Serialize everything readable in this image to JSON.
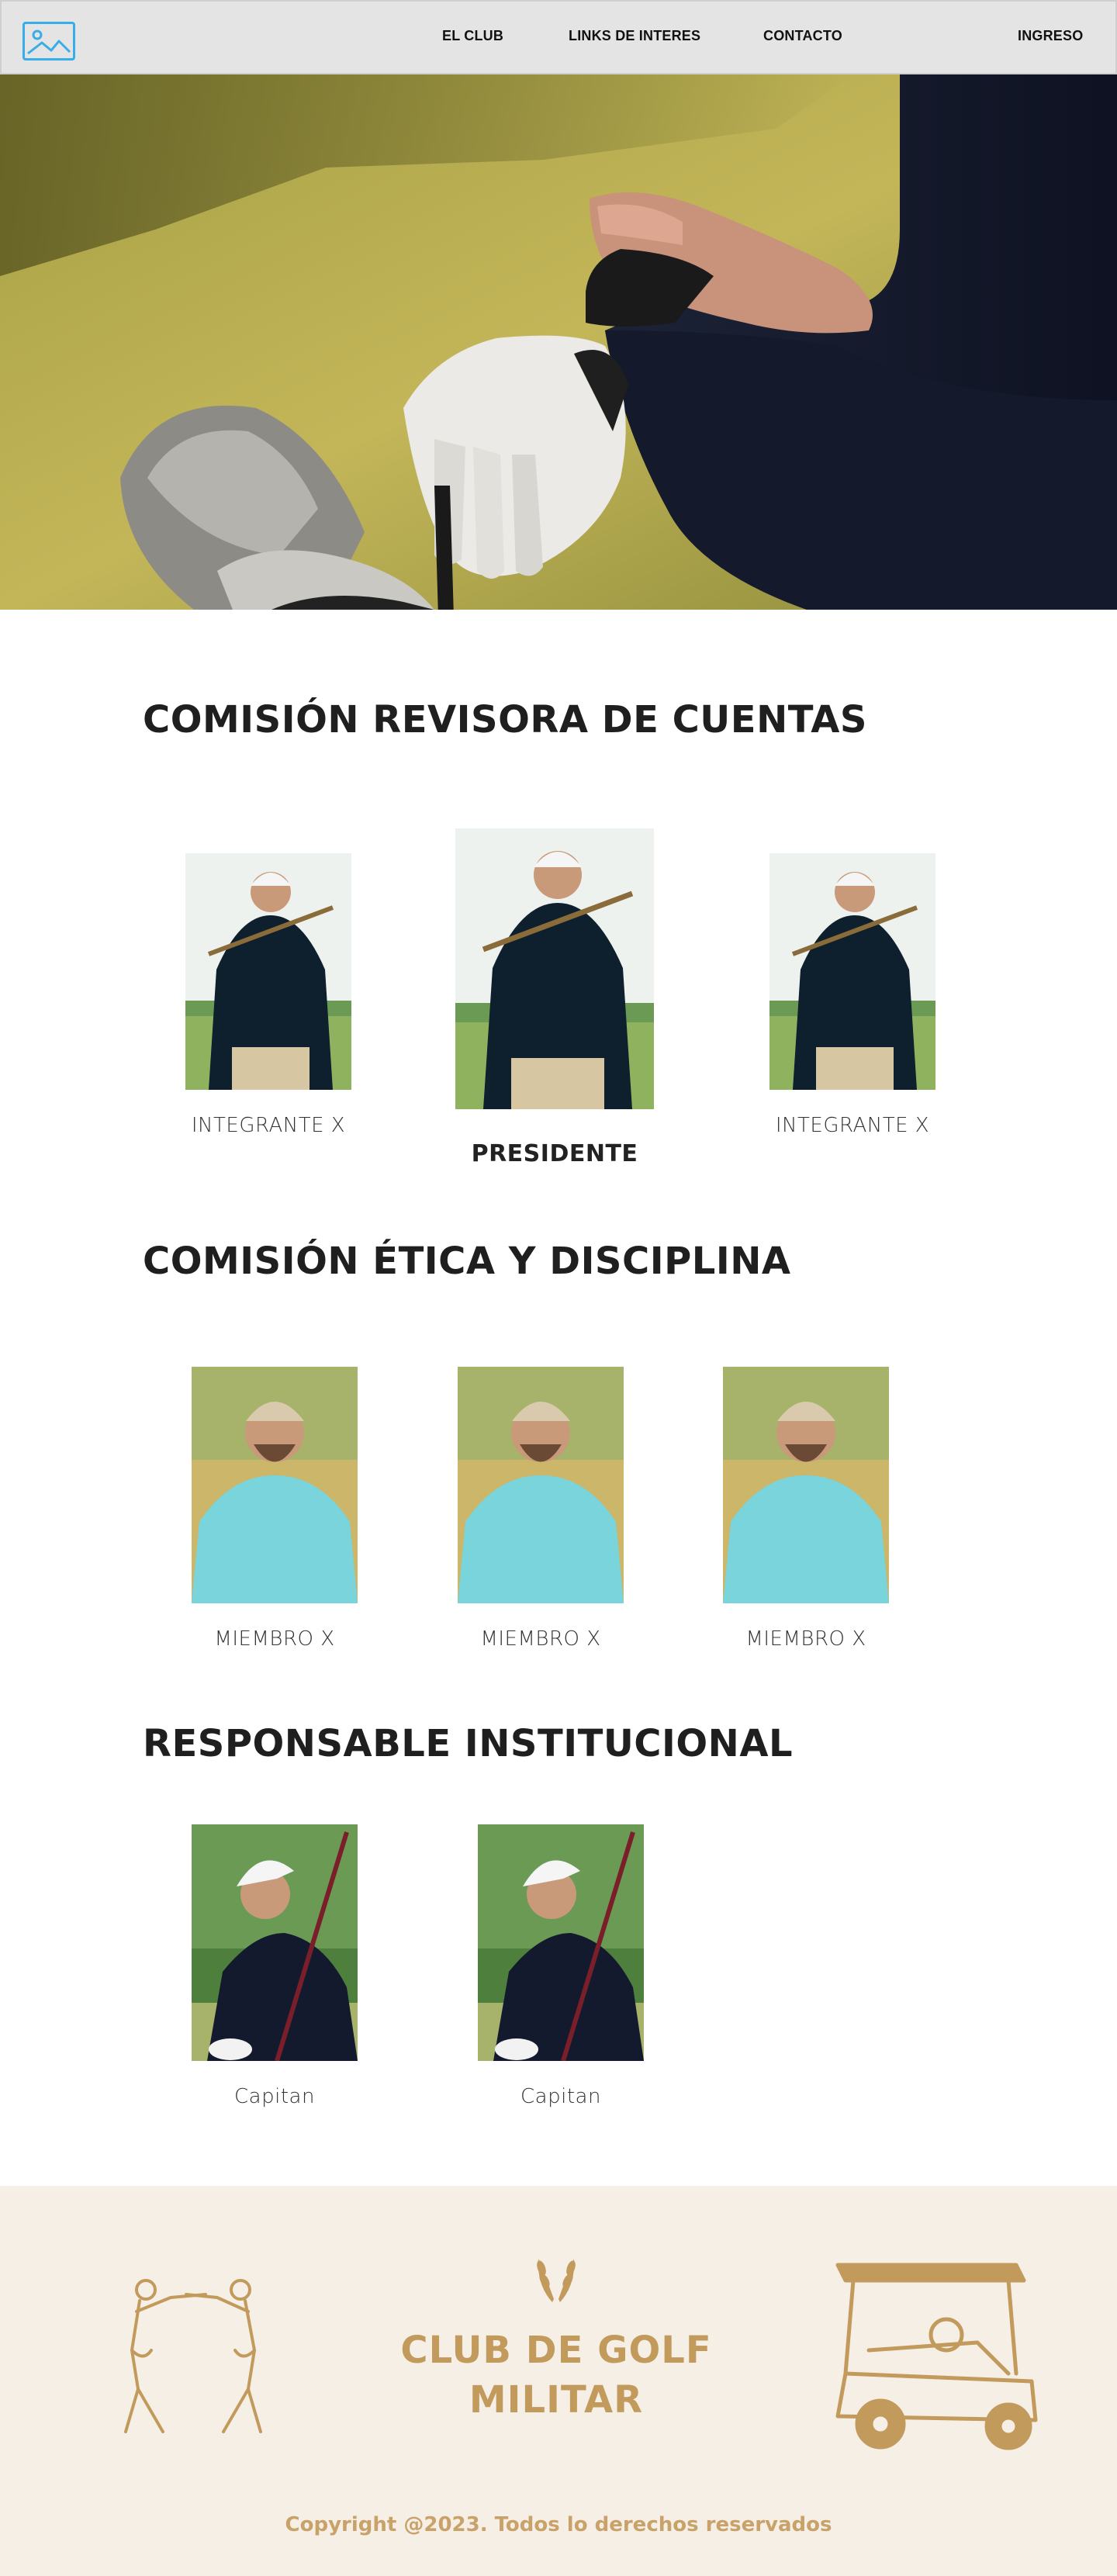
{
  "nav": {
    "links": [
      "EL CLUB",
      "LINKS DE INTERES",
      "CONTACTO"
    ],
    "login": "INGRESO"
  },
  "sections": {
    "revisora": {
      "title": "COMISIÓN REVISORA DE CUENTAS",
      "members": [
        "INTEGRANTE  X",
        "PRESIDENTE",
        "INTEGRANTE  X"
      ]
    },
    "etica": {
      "title": "COMISIÓN ÉTICA Y DISCIPLINA",
      "members": [
        "MIEMBRO X",
        "MIEMBRO X",
        "MIEMBRO X"
      ]
    },
    "responsable": {
      "title": "RESPONSABLE INSTITUCIONAL",
      "members": [
        "Capitan",
        "Capitan"
      ]
    }
  },
  "footer": {
    "club_name_line1": "CLUB DE GOLF",
    "club_name_line2": "MILITAR",
    "copyright": "Copyright @2023. Todos lo derechos reservados"
  },
  "colors": {
    "nav_bg": "#e4e4e4",
    "accent": "#37aee9",
    "footer_bg": "#f5efe6",
    "gold": "#c29a5c"
  },
  "icons": [
    "image-placeholder-icon",
    "golfers-illustration",
    "laurel-icon",
    "golf-cart-illustration"
  ]
}
